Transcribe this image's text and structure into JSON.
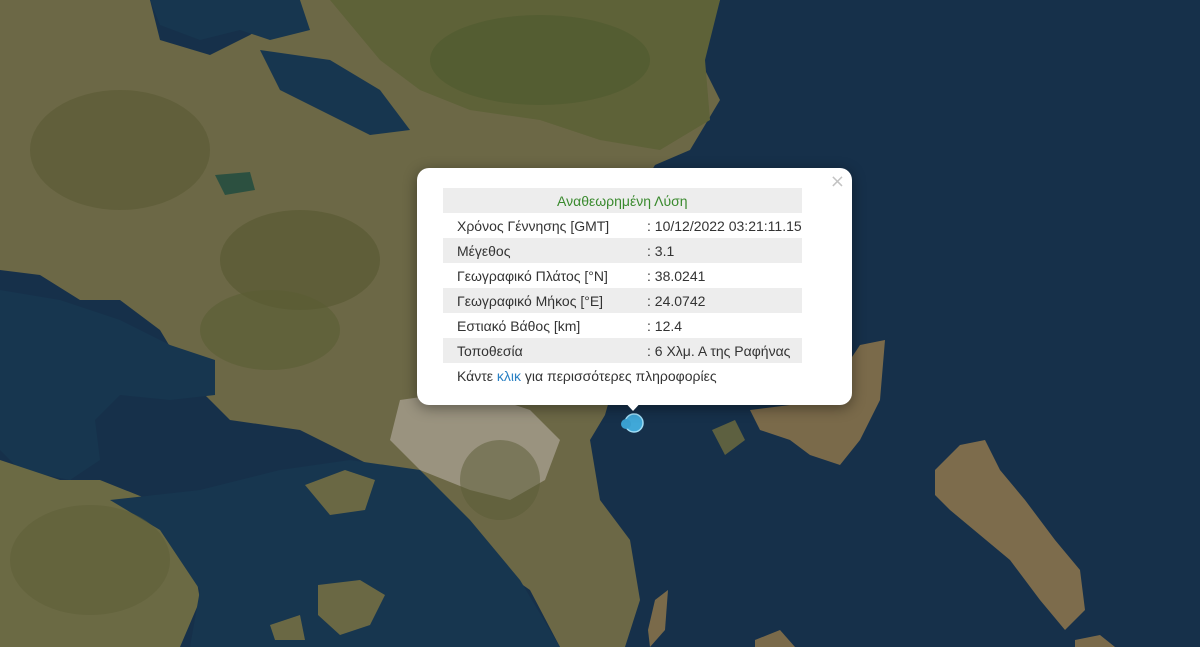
{
  "popup": {
    "title": "Αναθεωρημένη Λύση",
    "close_icon": "×",
    "rows": [
      {
        "label": "Χρόνος Γέννησης [GMT]",
        "value": ": 10/12/2022 03:21:11.15"
      },
      {
        "label": "Μέγεθος",
        "value": ": 3.1"
      },
      {
        "label": "Γεωγραφικό Πλάτος [°N]",
        "value": ": 38.0241"
      },
      {
        "label": "Γεωγραφικό Μήκος [°E]",
        "value": ": 24.0742"
      },
      {
        "label": "Εστιακό Βάθος [km]",
        "value": ": 12.4"
      },
      {
        "label": "Τοποθεσία",
        "value": ": 6 Χλμ. Α της Ραφήνας"
      }
    ],
    "more_prefix": "Κάντε ",
    "more_link": "κλικ",
    "more_suffix": " για περισσότερες πληροφορίες"
  },
  "map": {
    "style": "satellite",
    "colors": {
      "sea": "#16304a",
      "land": "#6e6a46",
      "urban": "#9c9584",
      "marker": "#40a8d8"
    }
  },
  "marker": {
    "icon": "earthquake-marker-icon"
  }
}
